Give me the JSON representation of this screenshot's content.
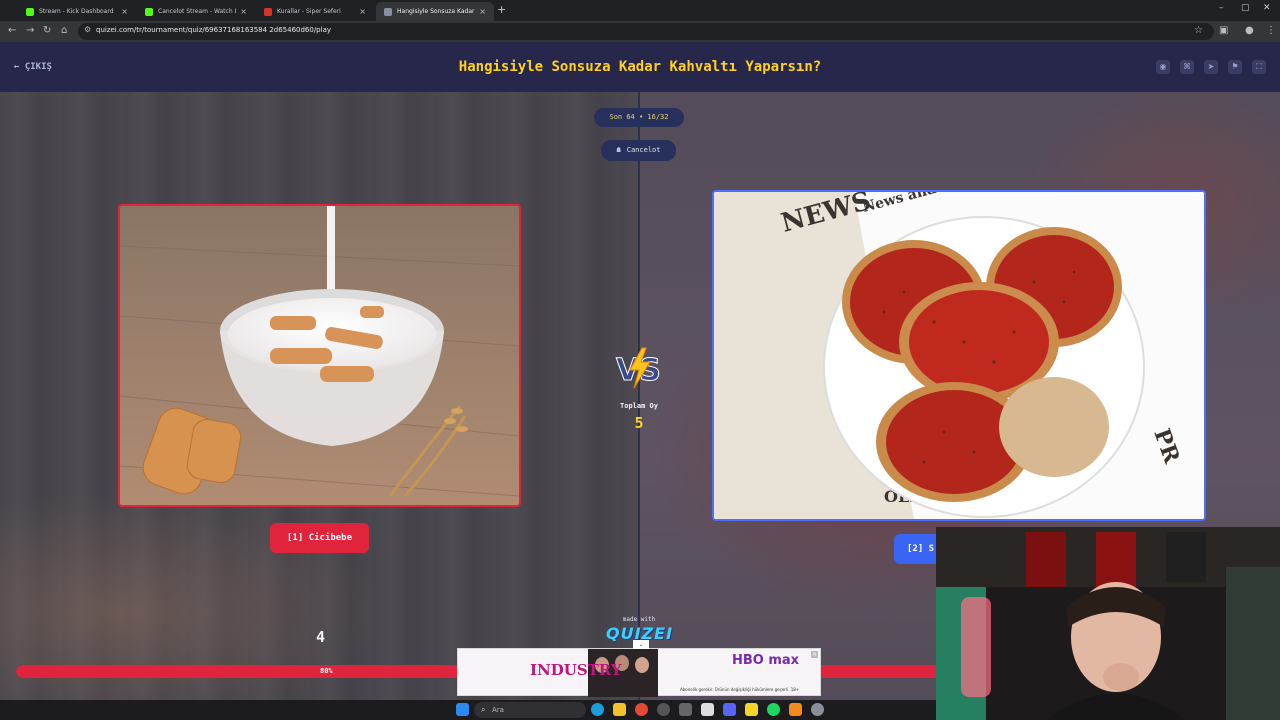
{
  "browser": {
    "tabs": [
      {
        "title": "Stream - Kick Dashboard",
        "favicon_color": "#53fc18",
        "active": false
      },
      {
        "title": "Cancelot Stream - Watch Live o",
        "favicon_color": "#53fc18",
        "active": false
      },
      {
        "title": "Kurallar - Siper Seferi",
        "favicon_color": "#d9342b",
        "active": false
      },
      {
        "title": "Hangisiyle Sonsuza Kadar Kahv",
        "favicon_color": "#8a8fa6",
        "active": true
      }
    ],
    "url": "quizei.com/tr/tournament/quiz/69637168163584 2d65460d60/play"
  },
  "header": {
    "exit_label": "ÇIKIŞ",
    "title": "Hangisiyle Sonsuza Kadar Kahvaltı Yaparsın?"
  },
  "round": {
    "label": "Son 64 • 16/32",
    "streamer": "Cancelot"
  },
  "left_option": {
    "label": "[1] Cicibebe",
    "votes": "4",
    "percent_label": "80%",
    "percent": 80,
    "accent": "#e0243b"
  },
  "right_option": {
    "label": "[2] S",
    "accent": "#3a64f2"
  },
  "vs": {
    "text": "VS",
    "total_label": "Toplam Oy",
    "total_value": "5"
  },
  "footer": {
    "made_with": "made with",
    "brand": "QUIZEI"
  },
  "ad": {
    "title": "INDUSTRY",
    "brand": "HBO max",
    "fine_print": "Abonelik gerekir. Ürünün değişikliği hükümlere geçerli. 18+"
  },
  "taskbar": {
    "search_placeholder": "Ara"
  }
}
